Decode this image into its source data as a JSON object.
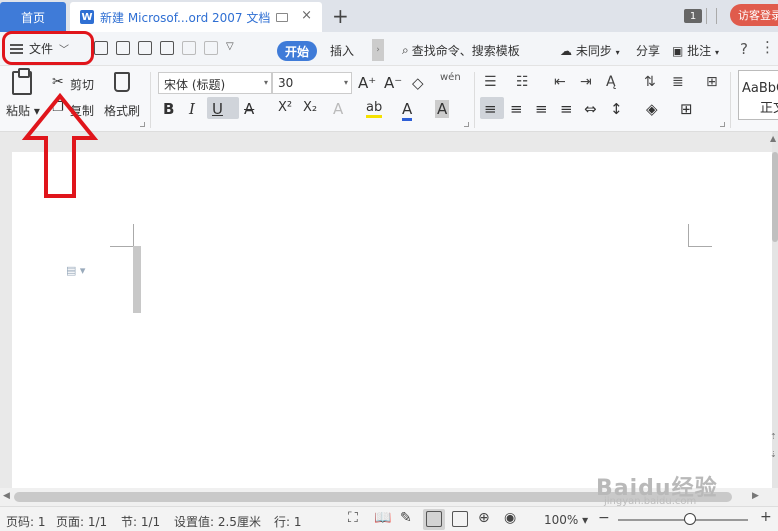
{
  "tabbar": {
    "home_tab": "首页",
    "doc_tab_icon": "W",
    "doc_tab_title": "新建 Microsof...ord 2007 文档",
    "close_glyph": "×",
    "new_tab_glyph": "+",
    "count_badge": "1",
    "login_button": "访客登录"
  },
  "menu": {
    "file_label": "文件",
    "start_tab": "开始",
    "insert_tab": "插入",
    "search_label": "查找命令、搜索模板",
    "sync_label": "未同步",
    "share_label": "分享",
    "annotate_label": "批注",
    "help_glyph": "?",
    "more_glyph": "⋮"
  },
  "ribbon": {
    "paste_label": "粘贴",
    "cut_label": "剪切",
    "copy_label": "复制",
    "format_painter_label": "格式刷",
    "font_name": "宋体 (标题)",
    "font_size": "30",
    "bold": "B",
    "italic": "I",
    "underline": "U",
    "strike": "A",
    "superscript": "X²",
    "subscript": "X₂",
    "font_color": "A",
    "char_shade": "A",
    "grow_font": "A⁺",
    "shrink_font": "A⁻",
    "phonetic": "wén",
    "style_preview": "AaBbC",
    "style_name": "正文"
  },
  "status": {
    "page_num": "页码: 1",
    "pages": "页面: 1/1",
    "section": "节: 1/1",
    "setting": "设置值: 2.5厘米",
    "row": "行: 1",
    "zoom": "100%",
    "zoom_minus": "−",
    "zoom_plus": "+"
  },
  "watermark": {
    "text": "Baidu经验",
    "sub": "jingyan.baidu.com"
  },
  "colors": {
    "accent": "#3f7bd8",
    "highlight_annotation": "#e0151b",
    "login": "#e05b4c"
  }
}
